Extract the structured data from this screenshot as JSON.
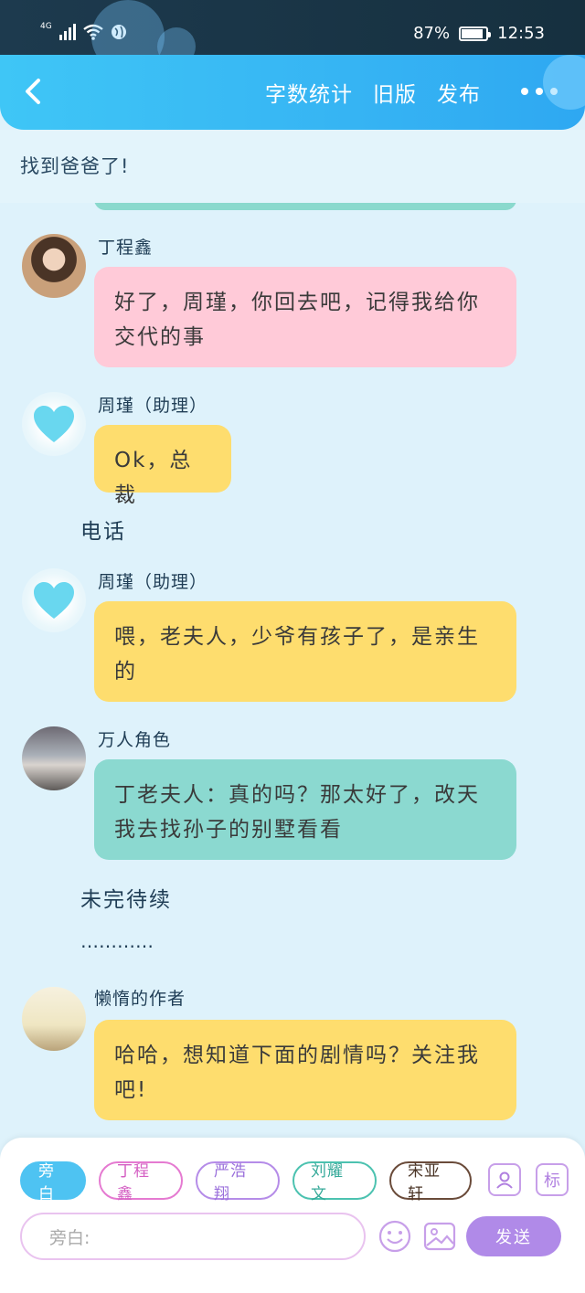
{
  "status_bar": {
    "network": "4G",
    "battery": "87%",
    "battery_level": 0.87,
    "time": "12:53"
  },
  "header": {
    "back_icon": "chevron-left-icon",
    "menu": [
      "字数统计",
      "旧版",
      "发布"
    ],
    "more_icon": "more-dots-icon"
  },
  "pinned_text": "找到爸爸了!",
  "messages": [
    {
      "type": "bubble",
      "name": "丁程鑫",
      "text": "好了，周瑾，你回去吧，记得我给你交代的事",
      "color": "#ffcad8"
    },
    {
      "type": "bubble",
      "name": "周瑾（助理）",
      "text": "Ok，总裁",
      "color": "#fedd6e"
    },
    {
      "type": "narration",
      "text": "电话"
    },
    {
      "type": "bubble",
      "name": "周瑾（助理）",
      "text": "喂，老夫人，少爷有孩子了，是亲生的",
      "color": "#fedd6e"
    },
    {
      "type": "bubble",
      "name": "万人角色",
      "text": "丁老夫人：真的吗？那太好了，改天我去找孙子的别墅看看",
      "color": "#8bd9d0"
    },
    {
      "type": "narration",
      "text": "未完待续"
    },
    {
      "type": "narration",
      "text": "…………"
    },
    {
      "type": "bubble",
      "name": "懒惰的作者",
      "text": "哈哈，想知道下面的剧情吗？关注我吧!",
      "color": "#fedd6e"
    }
  ],
  "composer": {
    "chips": [
      "旁白",
      "丁程鑫",
      "严浩翔",
      "刘耀文",
      "宋亚轩"
    ],
    "tool_icons": [
      "person-icon",
      "标"
    ],
    "input_placeholder": "旁白:",
    "emoji_icon": "smiley-icon",
    "image_icon": "image-icon",
    "send_label": "发送"
  },
  "colors": {
    "accent": "#36b4f3",
    "background": "#def2fb",
    "send": "#b08ae8"
  }
}
